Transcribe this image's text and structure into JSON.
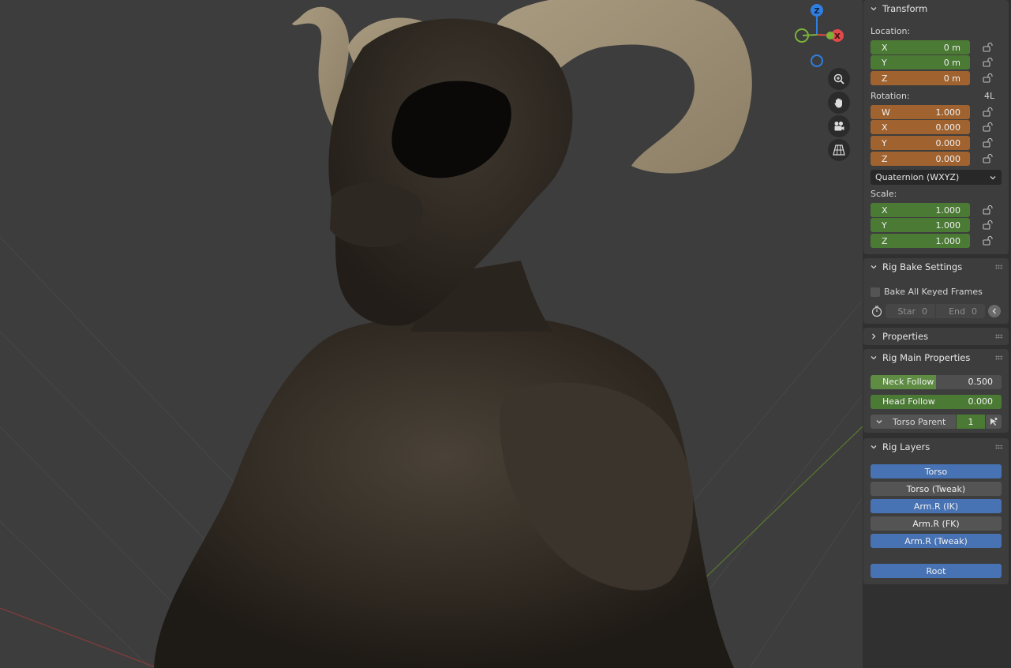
{
  "viewport": {
    "gizmo": {
      "z_label": "Z",
      "x_label": "X"
    },
    "nav_buttons": [
      "zoom-icon",
      "hand-pan-icon",
      "camera-icon",
      "grid-perspective-icon"
    ]
  },
  "transform": {
    "title": "Transform",
    "location_label": "Location:",
    "location": [
      {
        "axis": "X",
        "value": "0 m"
      },
      {
        "axis": "Y",
        "value": "0 m"
      },
      {
        "axis": "Z",
        "value": "0 m"
      }
    ],
    "rotation_label": "Rotation:",
    "rotation_badge": "4L",
    "rotation": [
      {
        "axis": "W",
        "value": "1.000"
      },
      {
        "axis": "X",
        "value": "0.000"
      },
      {
        "axis": "Y",
        "value": "0.000"
      },
      {
        "axis": "Z",
        "value": "0.000"
      }
    ],
    "rotation_mode": "Quaternion (WXYZ)",
    "scale_label": "Scale:",
    "scale": [
      {
        "axis": "X",
        "value": "1.000"
      },
      {
        "axis": "Y",
        "value": "1.000"
      },
      {
        "axis": "Z",
        "value": "1.000"
      }
    ]
  },
  "rig_bake": {
    "title": "Rig Bake Settings",
    "bake_all_label": "Bake All Keyed Frames",
    "start_label": "Star",
    "start_value": "0",
    "end_label": "End",
    "end_value": "0"
  },
  "properties": {
    "title": "Properties"
  },
  "rig_main": {
    "title": "Rig Main Properties",
    "neck_follow_label": "Neck Follow",
    "neck_follow_value": "0.500",
    "neck_follow_fraction": 0.5,
    "head_follow_label": "Head Follow",
    "head_follow_value": "0.000",
    "torso_parent_label": "Torso Parent",
    "torso_parent_value": "1"
  },
  "rig_layers": {
    "title": "Rig Layers",
    "layers": [
      {
        "label": "Torso",
        "active": true
      },
      {
        "label": "Torso (Tweak)",
        "active": false
      },
      {
        "label": "Arm.R (IK)",
        "active": true
      },
      {
        "label": "Arm.R (FK)",
        "active": false
      },
      {
        "label": "Arm.R (Tweak)",
        "active": true
      }
    ],
    "root_label": "Root"
  },
  "colors": {
    "green_field": "#4b7a35",
    "orange_field": "#a06330",
    "active_layer": "#4772b3",
    "inactive_layer": "#545454",
    "axis_x": "#e04a4a",
    "axis_y": "#7ab43a",
    "axis_z": "#2f7fe0"
  }
}
